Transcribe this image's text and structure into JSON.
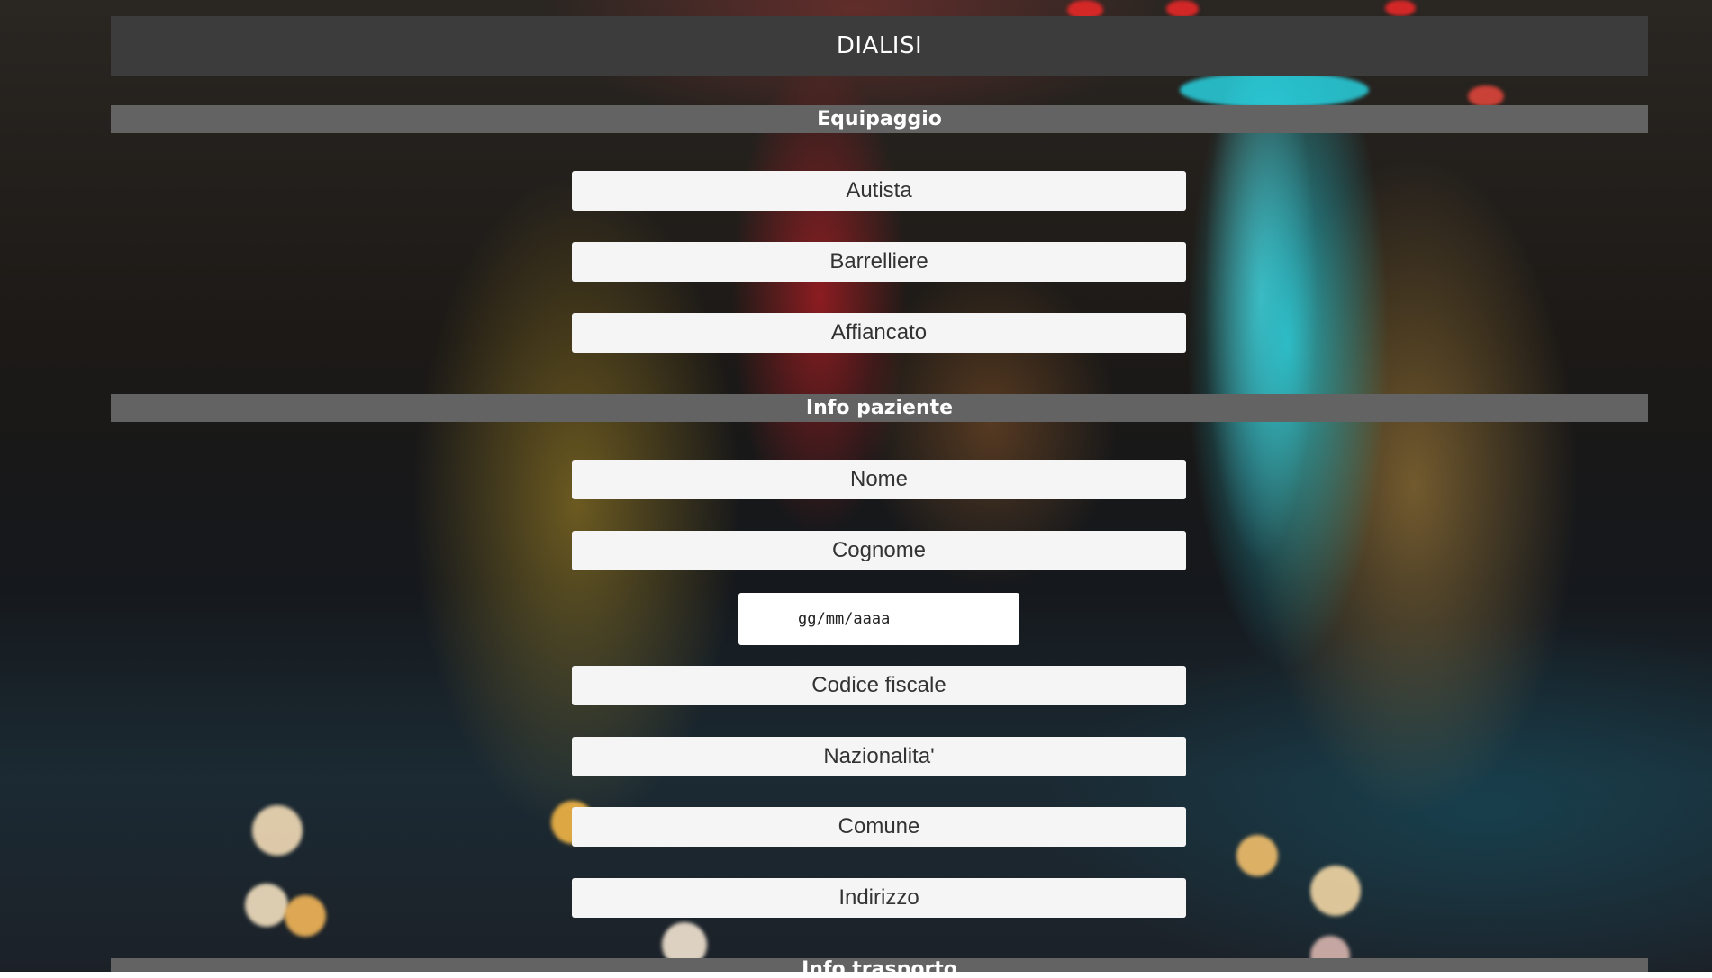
{
  "page": {
    "title": "DIALISI"
  },
  "sections": {
    "equipaggio": {
      "label": "Equipaggio",
      "fields": {
        "autista": "Autista",
        "barelliere": "Barrelliere",
        "affiancato": "Affiancato"
      }
    },
    "info_paziente": {
      "label": "Info paziente",
      "fields": {
        "nome": "Nome",
        "cognome": "Cognome",
        "data_nascita_placeholder": "gg/mm/aaaa",
        "codice_fiscale": "Codice fiscale",
        "nazionalita": "Nazionalita'",
        "comune": "Comune",
        "indirizzo": "Indirizzo"
      }
    },
    "info_trasporto": {
      "label": "Info trasporto"
    }
  }
}
